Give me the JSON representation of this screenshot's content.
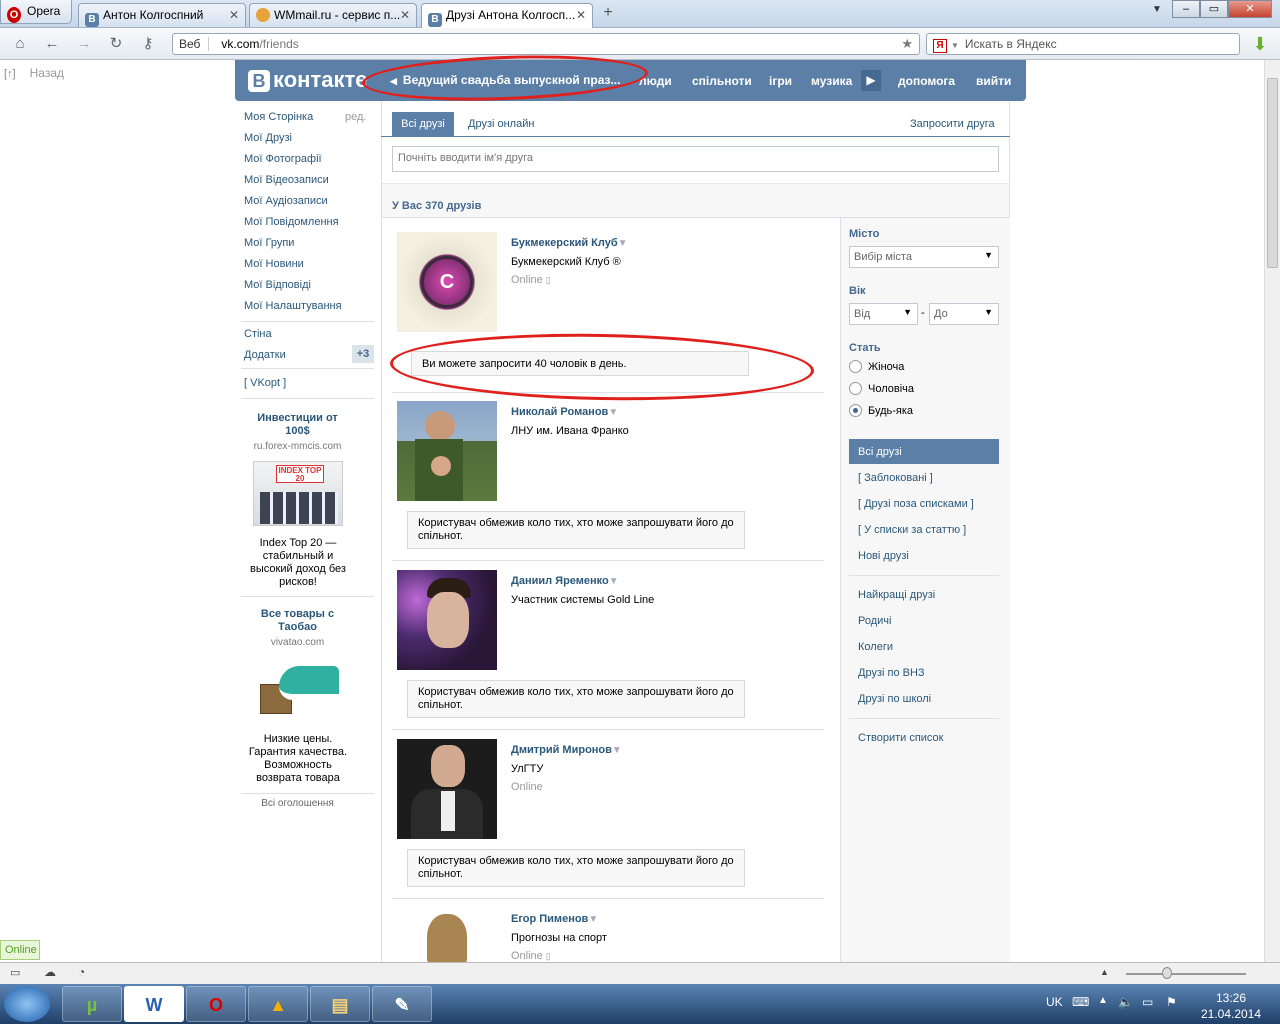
{
  "browser": {
    "opera_label": "Opera",
    "tabs": [
      {
        "title": "Антон Колгоспний",
        "icon": "vk-icon"
      },
      {
        "title": "WMmail.ru - сервис п...",
        "icon": "wmmail-icon"
      },
      {
        "title": "Друзі Антона Колгосп...",
        "icon": "vk-icon"
      }
    ],
    "address_prefix": "Веб",
    "address_host": "vk.com",
    "address_path": "/friends",
    "search_placeholder": "Искать в Яндекс",
    "back_label": "Назад",
    "back_tag": "[↑]"
  },
  "vk": {
    "logo": "контакте",
    "logo_letter": "В",
    "promo_text": "Ведущий свадьба выпускной праз...",
    "menu": [
      "люди",
      "спільноти",
      "ігри",
      "музика",
      "допомога",
      "вийти"
    ]
  },
  "sidebar": {
    "items": [
      "Моя Сторінка",
      "Мої Друзі",
      "Мої Фотографії",
      "Мої Відеозаписи",
      "Мої Аудіозаписи",
      "Мої Повідомлення",
      "Мої Групи",
      "Мої Новини",
      "Мої Відповіді",
      "Мої Налаштування"
    ],
    "edit_label": "ред.",
    "wall": "Стіна",
    "apps": "Додатки",
    "apps_badge": "+3",
    "vkopt": "[ VKopt ]"
  },
  "ads": [
    {
      "title": "Инвестиции от 100$",
      "domain": "ru.forex-mmcis.com",
      "image_text": "INDEX TOP 20",
      "text": "Index Top 20 — стабильный и высокий доход без рисков!"
    },
    {
      "title": "Все товары с Таобао",
      "domain": "vivatao.com",
      "text": "Низкие цены. Гарантия качества. Возможность возврата товара"
    }
  ],
  "all_ads": "Всі оголошення",
  "main": {
    "tab_all": "Всі друзі",
    "tab_online": "Друзі онлайн",
    "invite_link": "Запросити друга",
    "search_placeholder": "Почніть вводити ім'я друга",
    "friends_count": "У Вас 370 друзів"
  },
  "friends": [
    {
      "name": "Букмекерский Клуб",
      "sub": "Букмекерский Клуб ®",
      "online": "Online",
      "notice": "Ви можете запросити 40 чоловік в день."
    },
    {
      "name": "Николай Романов",
      "sub": "ЛНУ им. Ивана Франко",
      "online": "",
      "notice": "Користувач обмежив коло тих, хто може запрошувати його до спільнот."
    },
    {
      "name": "Даниил Яременко",
      "sub": "Участник системы Gold Line",
      "online": "",
      "notice": "Користувач обмежив коло тих, хто може запрошувати його до спільнот."
    },
    {
      "name": "Дмитрий Миронов",
      "sub": "УлГТУ",
      "online": "Online",
      "notice": "Користувач обмежив коло тих, хто може запрошувати його до спільнот."
    },
    {
      "name": "Егор Пименов",
      "sub": "Прогнозы на спорт",
      "online": "Online",
      "notice": ""
    }
  ],
  "filters": {
    "city_label": "Місто",
    "city_value": "Вибір міста",
    "age_label": "Вік",
    "age_from": "Від",
    "age_dash": "-",
    "age_to": "До",
    "sex_label": "Стать",
    "sex_options": [
      "Жіноча",
      "Чоловіча",
      "Будь-яка"
    ],
    "sex_selected": "Будь-яка",
    "lists": [
      "Всі друзі",
      "[ Заблоковані ]",
      "[ Друзі поза списками ]",
      "[ У списки за статтю ]",
      "Нові друзі"
    ],
    "lists2": [
      "Найкращі друзі",
      "Родичі",
      "Колеги",
      "Друзі по ВНЗ",
      "Друзі по школі"
    ],
    "create_list": "Створити список"
  },
  "status": {
    "online_badge": "Online"
  },
  "taskbar": {
    "lang": "UK",
    "time": "13:26",
    "date": "21.04.2014"
  },
  "colors": {
    "vk_blue": "#5b7fa6",
    "link": "#2b587a",
    "annotation": "#e0201c"
  }
}
